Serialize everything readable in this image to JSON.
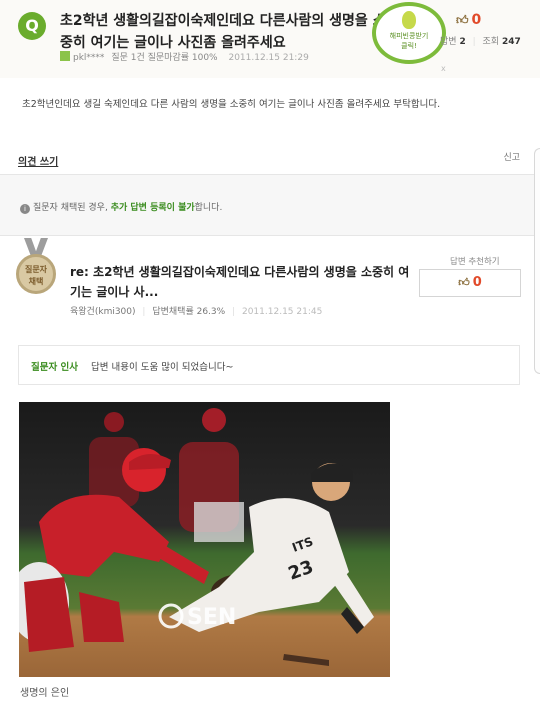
{
  "question": {
    "badge": "Q",
    "title": "초2학년 생활의길잡이숙제인데요 다른사람의 생명을 소중히 여기는 글이나 사진좀 올려주세요",
    "author": "pkl****",
    "author_stats": "질문 1건 질문마감률 100%",
    "date": "2011.12.15 21:29",
    "like_count": "0",
    "answer_stat_label": "답변",
    "answer_count": "2",
    "view_label": "조회",
    "view_count": "247",
    "stamp_line1": "해피빈콩받기",
    "stamp_line2": "클릭!",
    "small_mark": "x",
    "body": "초2학년인데요 생길 숙제인데요 다른 사람의 생명을 소중히 여기는 글이나 사진좀 올려주세요 부탁합니다."
  },
  "opinion": {
    "label": "의견 쓰기",
    "report": "신고"
  },
  "notice": {
    "prefix": "질문자 채택된 경우,",
    "emphasis": "추가 답변 등록이 불가",
    "suffix": "합니다."
  },
  "answer": {
    "medal_line1": "질문자",
    "medal_line2": "채택",
    "title": "re: 초2학년 생활의길잡이숙제인데요 다른사람의 생명을 소중히 여기는 글이나 사...",
    "author": "육왕건(kmi300)",
    "stats": "답변채택률 26.3%",
    "date": "2011.12.15 21:45",
    "recommend_label": "답변 추천하기",
    "recommend_count": "0"
  },
  "thanks": {
    "label": "질문자 인사",
    "text": "답변 내용이 도움 많이 되었습니다~"
  },
  "photo": {
    "watermark": "SEN",
    "runner_jersey": "ITS",
    "runner_number": "23",
    "caption": "생명의 은인"
  },
  "colors": {
    "green": "#3a8c1f",
    "like_red": "#e14a2a",
    "catcher_red": "#c8202a"
  }
}
